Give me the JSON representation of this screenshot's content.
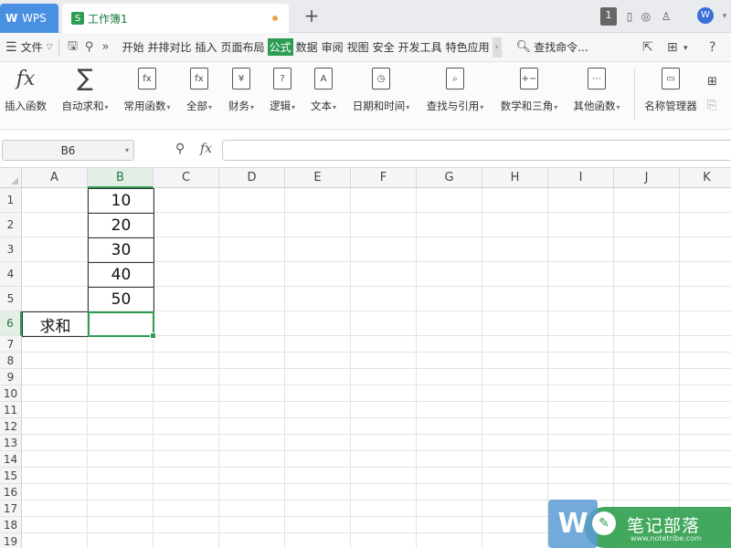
{
  "tabbar": {
    "app_tab_label": "WPS",
    "doc_tab_label": "工作簿1",
    "doc_icon_glyph": "S",
    "new_tab_glyph": "+",
    "window_count": "1"
  },
  "menubar": {
    "file_label": "文件",
    "tabs": [
      "开始",
      "并排对比",
      "插入",
      "页面布局",
      "公式",
      "数据",
      "审阅",
      "视图",
      "安全",
      "开发工具",
      "特色应用"
    ],
    "active_tab": "公式",
    "more_glyph": "›",
    "search_label": "查找命令...",
    "help_glyph": "?"
  },
  "ribbon": {
    "items": [
      {
        "label": "插入函数",
        "icon": "fx-icon",
        "glyph": "fx",
        "dropdown": false
      },
      {
        "label": "自动求和",
        "icon": "sigma-icon",
        "glyph": "∑",
        "dropdown": true
      },
      {
        "label": "常用函数",
        "icon": "star-function-icon",
        "glyph": "fx",
        "dropdown": true
      },
      {
        "label": "全部",
        "icon": "all-functions-icon",
        "glyph": "fx",
        "dropdown": true
      },
      {
        "label": "财务",
        "icon": "finance-icon",
        "glyph": "¥",
        "dropdown": true
      },
      {
        "label": "逻辑",
        "icon": "logic-icon",
        "glyph": "?",
        "dropdown": true
      },
      {
        "label": "文本",
        "icon": "text-icon",
        "glyph": "A",
        "dropdown": true
      },
      {
        "label": "日期和时间",
        "icon": "clock-icon",
        "glyph": "◷",
        "dropdown": true
      },
      {
        "label": "查找与引用",
        "icon": "lookup-icon",
        "glyph": "⌕",
        "dropdown": true
      },
      {
        "label": "数学和三角",
        "icon": "math-icon",
        "glyph": "+−",
        "dropdown": true
      },
      {
        "label": "其他函数",
        "icon": "more-functions-icon",
        "glyph": "⋯",
        "dropdown": true
      },
      {
        "label": "名称管理器",
        "icon": "name-manager-icon",
        "glyph": "▭",
        "dropdown": false
      }
    ]
  },
  "formula_bar": {
    "cell_ref": "B6",
    "fx_label": "fx",
    "formula_value": ""
  },
  "sheet": {
    "columns": [
      "A",
      "B",
      "C",
      "D",
      "E",
      "F",
      "G",
      "H",
      "I",
      "J",
      "K"
    ],
    "rows": [
      "1",
      "2",
      "3",
      "4",
      "5",
      "6",
      "7",
      "8",
      "9",
      "10",
      "11",
      "12",
      "13",
      "14",
      "15",
      "16",
      "17",
      "18",
      "19"
    ],
    "selected_column": "B",
    "selected_row": "6",
    "cells": {
      "B1": "10",
      "B2": "20",
      "B3": "30",
      "B4": "40",
      "B5": "50",
      "A6": "求和",
      "B6": ""
    }
  },
  "watermark": {
    "title": "笔记部落",
    "url": "www.notetribe.com",
    "logo_glyph": "W"
  },
  "colors": {
    "accent_green": "#2e9c52",
    "wps_blue": "#4a90e2"
  }
}
